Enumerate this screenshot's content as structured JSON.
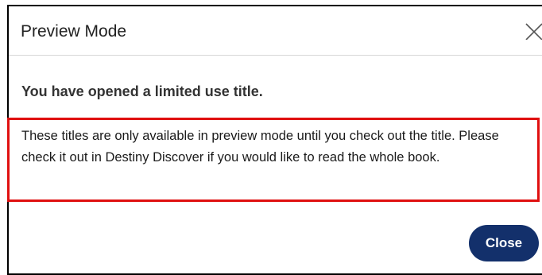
{
  "dialog": {
    "title": "Preview Mode",
    "close_icon": "close-icon",
    "heading": "You have opened a limited use title.",
    "message": "These titles are only available in preview mode until you check out the title. Please check it out in Destiny Discover if you would like to read the whole book.",
    "close_button_label": "Close"
  },
  "colors": {
    "primary_button": "#13306b",
    "highlight_border": "#e01010"
  }
}
